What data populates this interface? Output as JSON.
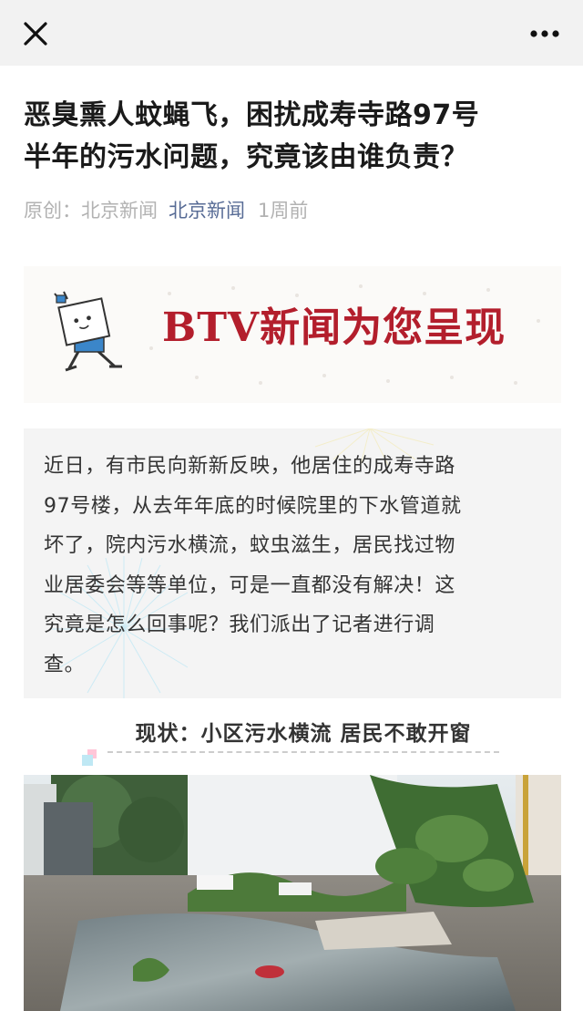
{
  "topbar": {
    "close_icon": "close-icon",
    "more_icon": "more-dots-icon"
  },
  "article": {
    "title_lines": [
      "恶臭熏人蚊蝇飞，困扰成寿寺路97号",
      "半年的污水问题，究竟该由谁负责？"
    ],
    "meta": {
      "original": "原创：北京新闻",
      "account": "北京新闻",
      "time": "1周前"
    },
    "banner": {
      "text": "BTV新闻为您呈现",
      "mascot_icon": "btv-mascot-icon",
      "text_color": "#b31e2c"
    },
    "intro_lines": [
      "近日，有市民向新新反映，他居住的成寿寺路",
      "97号楼，从去年年底的时候院里的下水管道就",
      "坏了，院内污水横流，蚊虫滋生，居民找过物",
      "业居委会等等单位，可是一直都没有解决！这",
      "究竟是怎么回事呢？我们派出了记者进行调",
      "查。"
    ],
    "subheading": "现状：小区污水横流 居民不敢开窗"
  },
  "colors": {
    "topbar_bg": "#f2f2f2",
    "account_link": "#576b95",
    "meta_grey": "#b2b2b2"
  }
}
